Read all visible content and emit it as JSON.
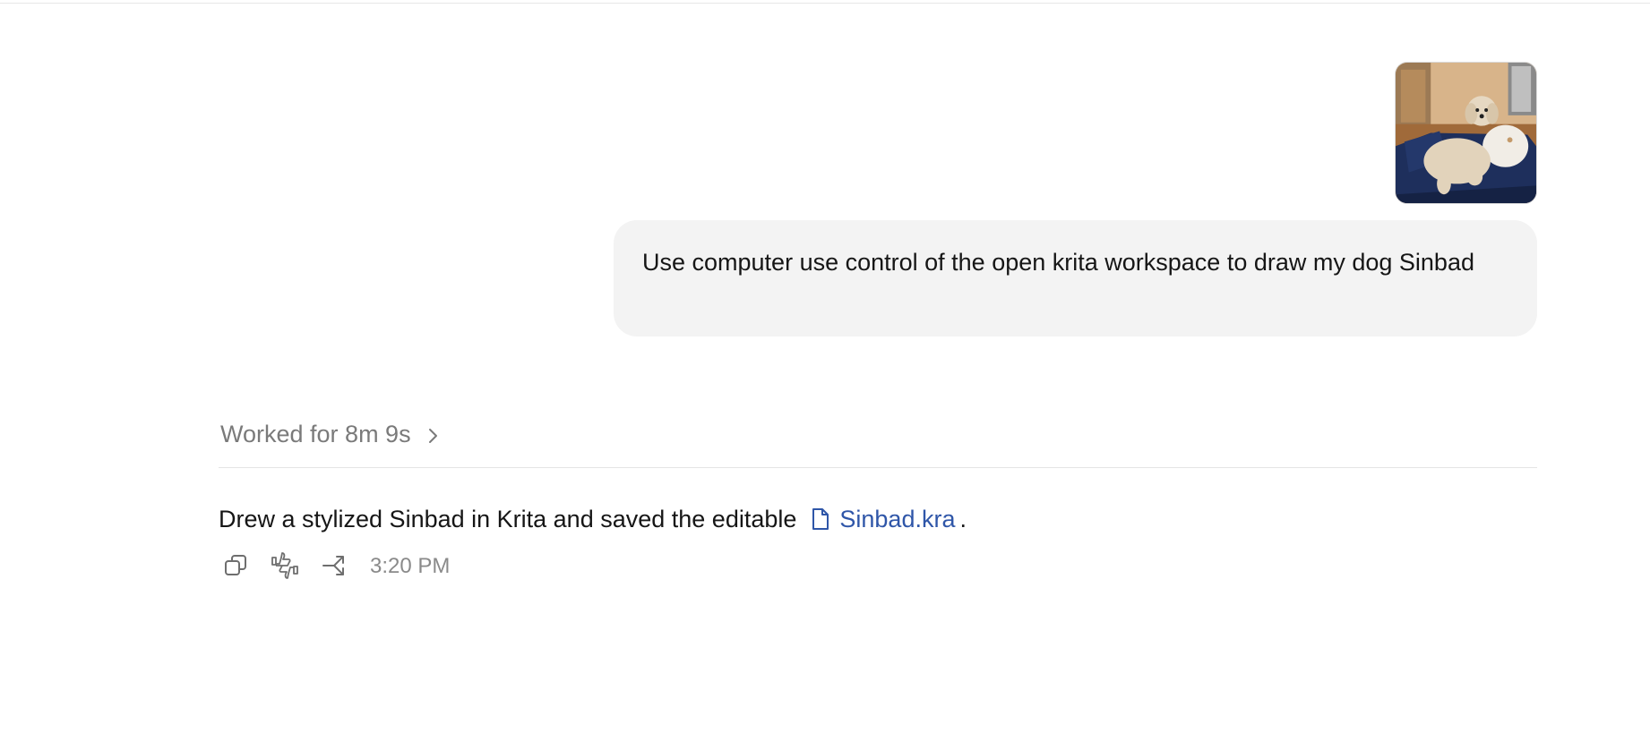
{
  "conversation": {
    "user_message": {
      "attachment_icon": "dog-photo-image",
      "text": "Use computer use control of the open krita workspace to draw my dog Sinbad"
    },
    "work_summary": {
      "label": "Worked for 8m 9s",
      "icon": "chevron-right-icon"
    },
    "assistant_reply": {
      "text": "Drew a stylized Sinbad in Krita and saved the editable",
      "file_icon": "file-icon",
      "file_name": "Sinbad.kra",
      "trailing": "."
    },
    "actions": {
      "icons": [
        "copy-icon",
        "thumbs-up-down-icon",
        "share-icon"
      ],
      "timestamp": "3:20 PM"
    }
  },
  "colors": {
    "bubble_bg": "#f3f3f3",
    "link": "#2f56a8",
    "muted_text": "#7a7a7a"
  }
}
